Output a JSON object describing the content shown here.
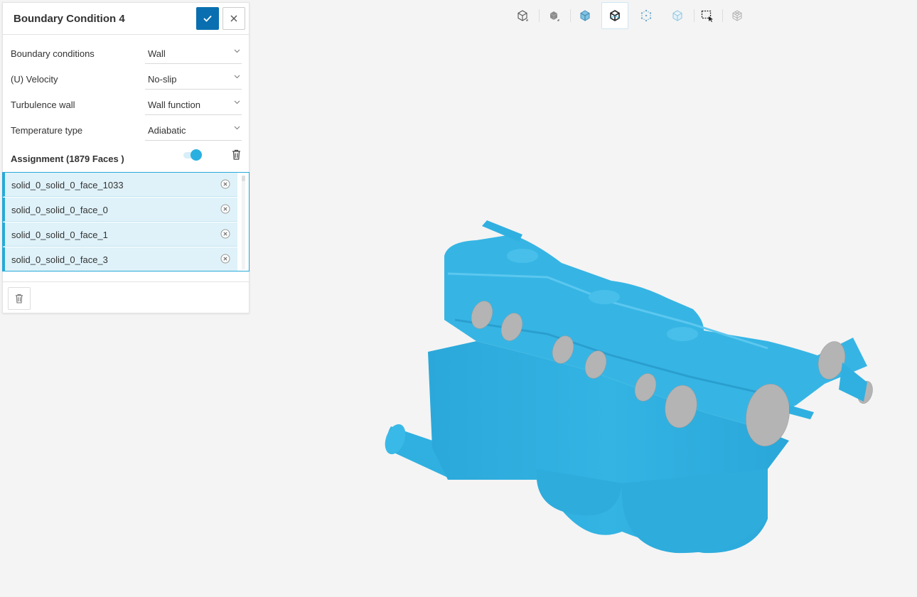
{
  "panel": {
    "title": "Boundary Condition 4",
    "confirm_icon": "check-icon",
    "close_icon": "close-icon",
    "properties": [
      {
        "label": "Boundary conditions",
        "value": "Wall"
      },
      {
        "label": "(U) Velocity",
        "value": "No-slip"
      },
      {
        "label": "Turbulence wall",
        "value": "Wall function"
      },
      {
        "label": "Temperature type",
        "value": "Adiabatic"
      }
    ],
    "assignment_label": "Assignment (1879 Faces )",
    "toggle_on": true,
    "faces": [
      "solid_0_solid_0_face_1033",
      "solid_0_solid_0_face_0",
      "solid_0_solid_0_face_1",
      "solid_0_solid_0_face_3"
    ]
  },
  "toolbar": {
    "buttons": [
      "reset-view-icon",
      "solid-view-icon",
      "transparent-solid-icon",
      "wireframe-solid-icon",
      "points-icon",
      "faces-icon",
      "box-select-icon",
      "mesh-view-icon"
    ],
    "active": "wireframe-solid-icon"
  },
  "colors": {
    "accent": "#0a6fb0",
    "model": "#2eb0e0",
    "selection": "#dff2f9",
    "opening": "#b4b4b4"
  }
}
